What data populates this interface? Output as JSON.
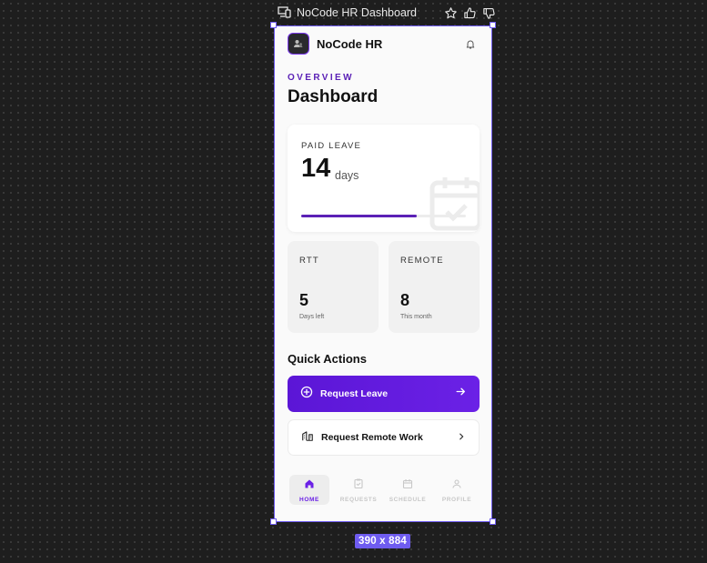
{
  "toolbar": {
    "title": "NoCode HR Dashboard",
    "icons": [
      "devices-icon",
      "star-icon",
      "thumbs-up-icon",
      "thumbs-down-icon"
    ]
  },
  "frame": {
    "size_label": "390 x 884"
  },
  "app": {
    "name": "NoCode HR",
    "overline": "OVERVIEW",
    "title": "Dashboard"
  },
  "paid_leave": {
    "label": "PAID LEAVE",
    "value": "14",
    "unit": "days",
    "progress": 0.7
  },
  "stats": [
    {
      "label": "RTT",
      "value": "5",
      "sub": "Days left"
    },
    {
      "label": "REMOTE",
      "value": "8",
      "sub": "This month"
    }
  ],
  "quick_actions": {
    "title": "Quick Actions",
    "primary": {
      "label": "Request Leave",
      "icon": "plus-circle-icon"
    },
    "secondary": {
      "label": "Request Remote Work",
      "icon": "building-icon"
    }
  },
  "nav": [
    {
      "label": "HOME",
      "icon": "home-icon",
      "active": true
    },
    {
      "label": "REQUESTS",
      "icon": "clipboard-icon",
      "active": false
    },
    {
      "label": "SCHEDULE",
      "icon": "calendar-icon",
      "active": false
    },
    {
      "label": "PROFILE",
      "icon": "person-icon",
      "active": false
    }
  ],
  "colors": {
    "accent": "#5b21b6",
    "primary_button": "#6b21e6",
    "selection": "#6f5cf0",
    "canvas": "#1e1e1e"
  }
}
